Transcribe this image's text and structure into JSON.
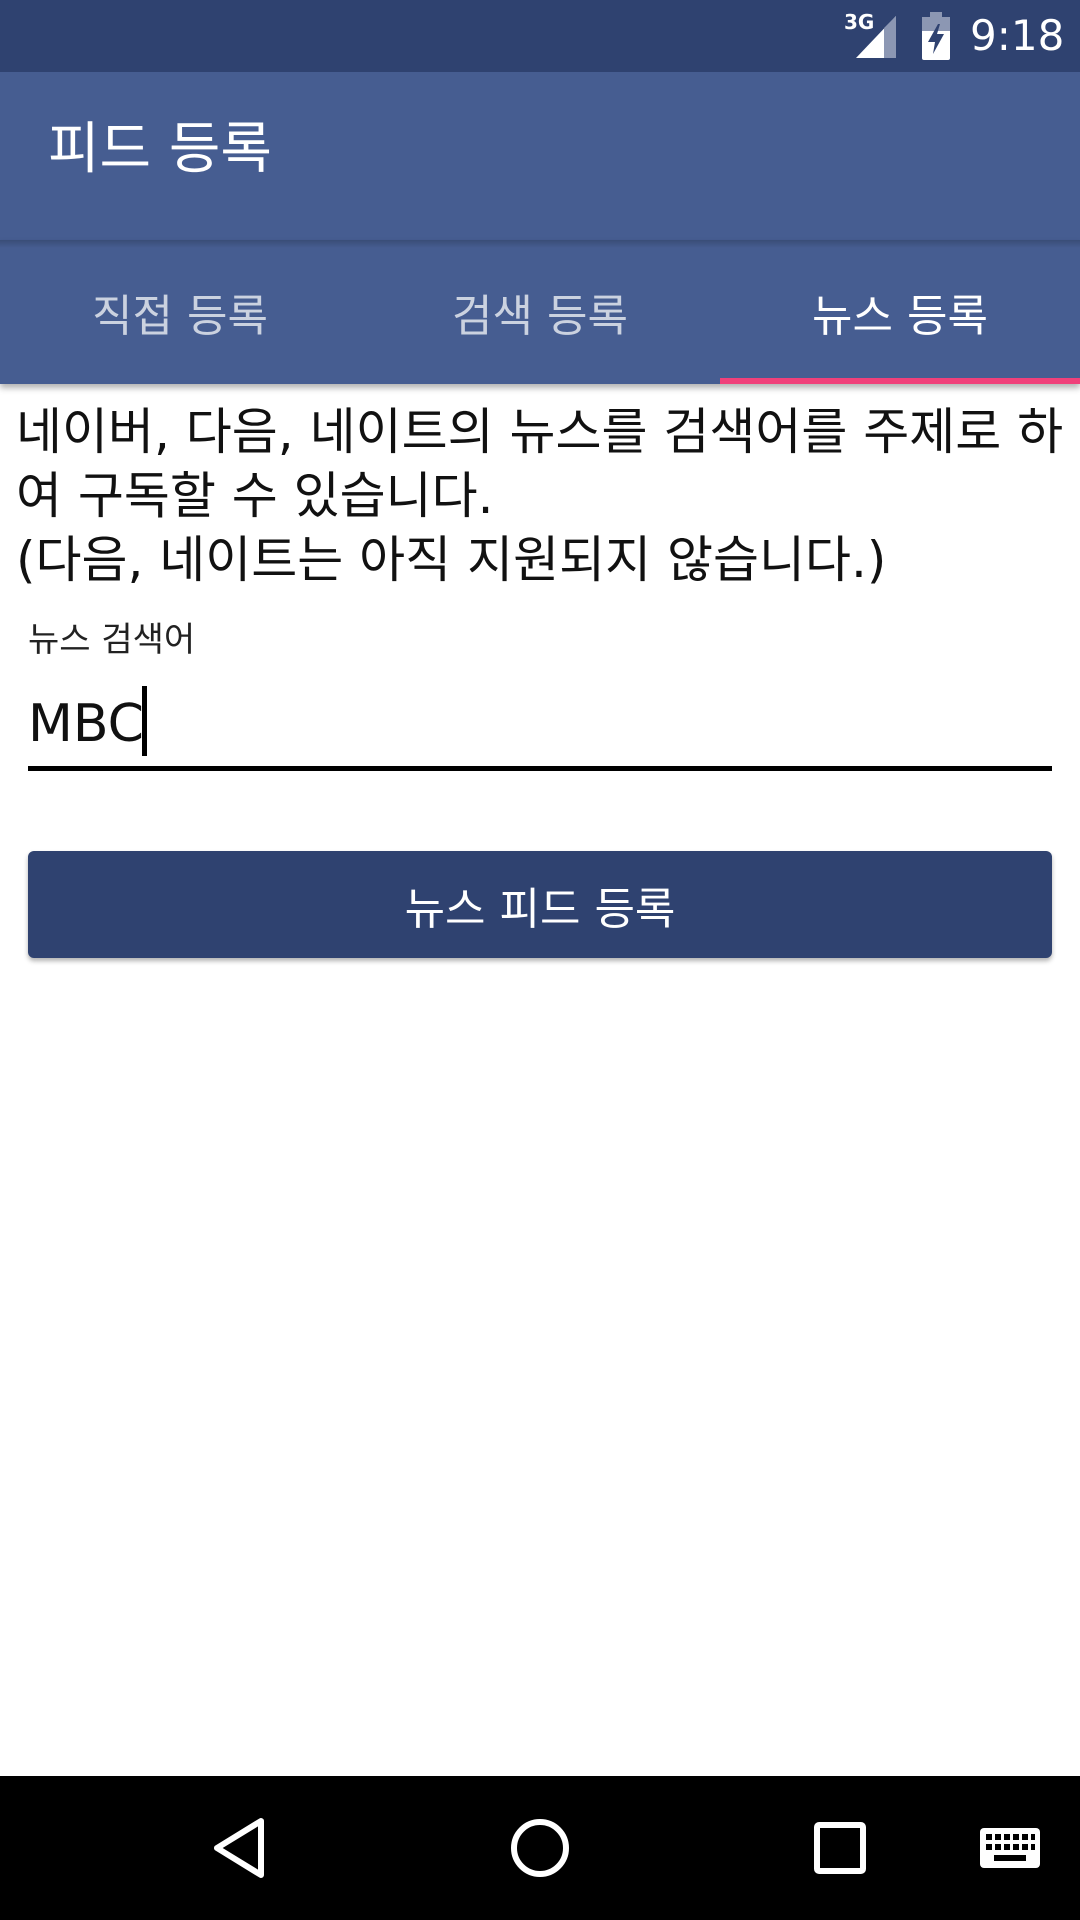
{
  "status_bar": {
    "network": "3G",
    "time": "9:18",
    "icons": [
      "signal-icon",
      "battery-charging-icon"
    ]
  },
  "app_bar": {
    "title": "피드 등록"
  },
  "tabs": [
    {
      "label": "직접 등록",
      "selected": false
    },
    {
      "label": "검색 등록",
      "selected": false
    },
    {
      "label": "뉴스 등록",
      "selected": true
    }
  ],
  "content": {
    "description": " 네이버, 다음, 네이트의 뉴스를 검색어를 주제로 하여 구독할 수 있습니다.\n(다음, 네이트는 아직 지원되지 않습니다.)",
    "search_label": "뉴스 검색어",
    "search_value": "MBC",
    "register_button": "뉴스 피드 등록"
  },
  "nav_bar": {
    "icons": [
      "back-icon",
      "home-icon",
      "recents-icon",
      "keyboard-icon"
    ]
  },
  "colors": {
    "status_bar": "#2f4270",
    "app_bar": "#465d91",
    "tab_indicator": "#f0407a",
    "button": "#2f4270"
  }
}
